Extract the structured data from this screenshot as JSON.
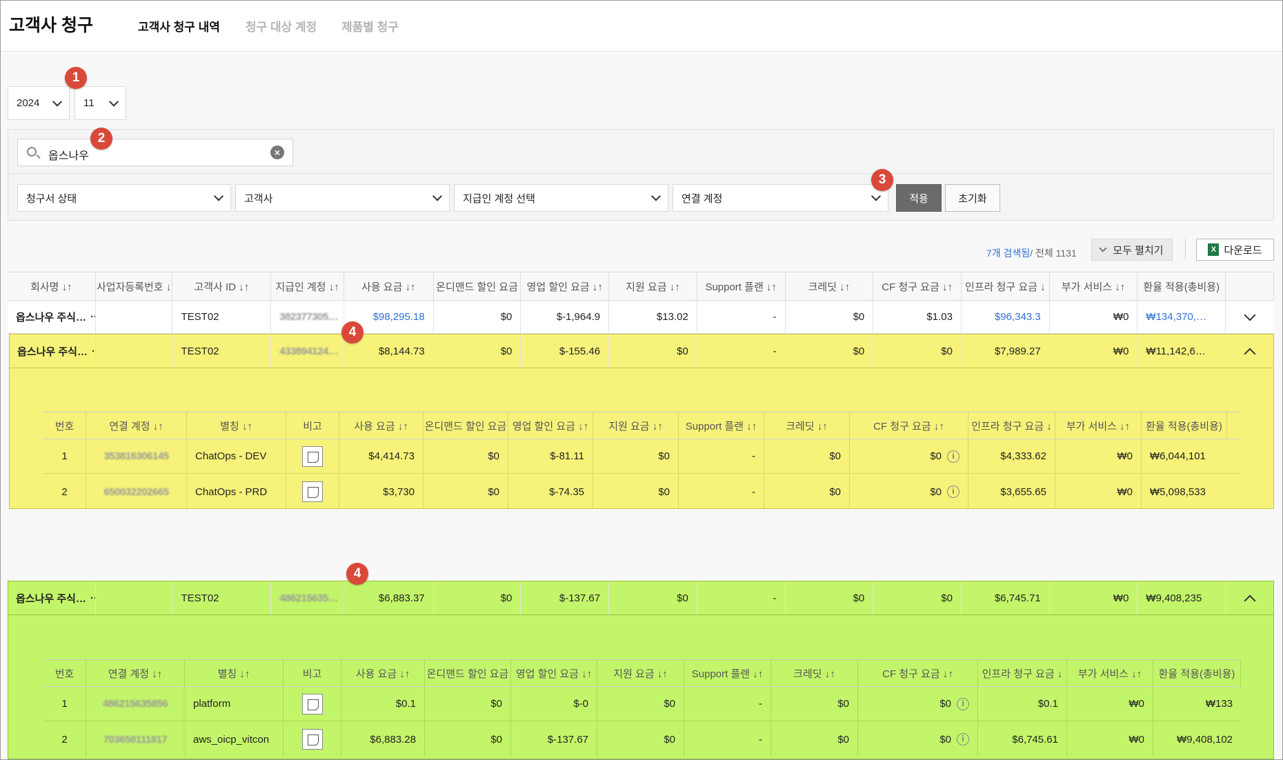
{
  "header": {
    "title": "고객사 청구",
    "tabs": [
      {
        "label": "고객사 청구 내역",
        "active": true
      },
      {
        "label": "청구 대상 계정",
        "active": false
      },
      {
        "label": "제품별 청구",
        "active": false
      }
    ]
  },
  "period": {
    "year": "2024",
    "month": "11"
  },
  "search": {
    "value": "옵스나우",
    "clear_icon": "clear-circle-icon"
  },
  "filters": {
    "invoice_status": "청구서 상태",
    "customer": "고객사",
    "payer_account": "지급인 계정 선택",
    "linked_account": "연결 계정",
    "apply_label": "적용",
    "reset_label": "초기화"
  },
  "badges": [
    "1",
    "2",
    "3",
    "4",
    "4"
  ],
  "results": {
    "found": "7개 검색됨",
    "total": "/ 전체 1131"
  },
  "toolbar": {
    "expand_all": "모두 펼치기",
    "download": "다운로드",
    "excel_icon": "X"
  },
  "main_table": {
    "headers": [
      "회사명 ↓↑",
      "사업자등록번호 ↓",
      "고객사 ID ↓↑",
      "지급인 계정 ↓↑",
      "사용 요금 ↓↑",
      "온디맨드 할인 요금",
      "영업 할인 요금 ↓↑",
      "지원 요금 ↓↑",
      "Support 플랜 ↓↑",
      "크레딧 ↓↑",
      "CF 청구 요금 ↓↑",
      "인프라 청구 요금 ↓",
      "부가 서비스 ↓↑",
      "환율 적용(총비용)"
    ],
    "rows": [
      {
        "company": "옵스나우 주식…",
        "more": "···",
        "biz_no": "",
        "customer_id": "TEST02",
        "payer": "382377305…",
        "usage": "$98,295.18",
        "ondemand": "$0",
        "sales_disc": "$-1,964.9",
        "support": "$13.02",
        "plan": "-",
        "credit": "$0",
        "cf": "$1.03",
        "infra": "$96,343.3",
        "addon": "₩0",
        "fx_total": "₩134,370,…"
      },
      {
        "company": "옵스나우 주식…",
        "more": "···",
        "biz_no": "",
        "customer_id": "TEST02",
        "payer": "433894124…",
        "usage": "$8,144.73",
        "ondemand": "$0",
        "sales_disc": "$-155.46",
        "support": "$0",
        "plan": "-",
        "credit": "$0",
        "cf": "$0",
        "infra": "$7,989.27",
        "addon": "₩0",
        "fx_total": "₩11,142,6…"
      },
      {
        "company": "옵스나우 주식…",
        "more": "···",
        "biz_no": "",
        "customer_id": "TEST02",
        "payer": "486215635…",
        "usage": "$6,883.37",
        "ondemand": "$0",
        "sales_disc": "$-137.67",
        "support": "$0",
        "plan": "-",
        "credit": "$0",
        "cf": "$0",
        "infra": "$6,745.71",
        "addon": "₩0",
        "fx_total": "₩9,408,235"
      }
    ]
  },
  "sub_headers": [
    "번호",
    "연결 계정 ↓↑",
    "별칭 ↓↑",
    "비고",
    "사용 요금 ↓↑",
    "온디맨드 할인 요금",
    "영업 할인 요금 ↓↑",
    "지원 요금 ↓↑",
    "Support 플랜 ↓↑",
    "크레딧 ↓↑",
    "CF 청구 요금 ↓↑",
    "인프라 청구 요금 ↓",
    "부가 서비스 ↓↑",
    "환율 적용(총비용)"
  ],
  "sub_tables": [
    {
      "rows": [
        {
          "no": "1",
          "linked": "353816306145",
          "alias": "ChatOps - DEV",
          "usage": "$4,414.73",
          "ondemand": "$0",
          "sales_disc": "$-81.11",
          "support": "$0",
          "plan": "-",
          "credit": "$0",
          "cf": "$0",
          "infra": "$4,333.62",
          "addon": "₩0",
          "fx_total": "₩6,044,101"
        },
        {
          "no": "2",
          "linked": "650032202665",
          "alias": "ChatOps - PRD",
          "usage": "$3,730",
          "ondemand": "$0",
          "sales_disc": "$-74.35",
          "support": "$0",
          "plan": "-",
          "credit": "$0",
          "cf": "$0",
          "infra": "$3,655.65",
          "addon": "₩0",
          "fx_total": "₩5,098,533"
        }
      ]
    },
    {
      "rows": [
        {
          "no": "1",
          "linked": "486215635856",
          "alias": "platform",
          "usage": "$0.1",
          "ondemand": "$0",
          "sales_disc": "$-0",
          "support": "$0",
          "plan": "-",
          "credit": "$0",
          "cf": "$0",
          "infra": "$0.1",
          "addon": "₩0",
          "fx_total": "₩133"
        },
        {
          "no": "2",
          "linked": "703658111817",
          "alias": "aws_oicp_vitcon",
          "usage": "$6,883.28",
          "ondemand": "$0",
          "sales_disc": "$-137.67",
          "support": "$0",
          "plan": "-",
          "credit": "$0",
          "cf": "$0",
          "infra": "$6,745.61",
          "addon": "₩0",
          "fx_total": "₩9,408,102"
        }
      ]
    }
  ],
  "colors": {
    "yellow_highlight": "#f7f37a",
    "green_highlight": "#c3f56a",
    "badge": "#d9493a",
    "link": "#2f6fd6"
  }
}
